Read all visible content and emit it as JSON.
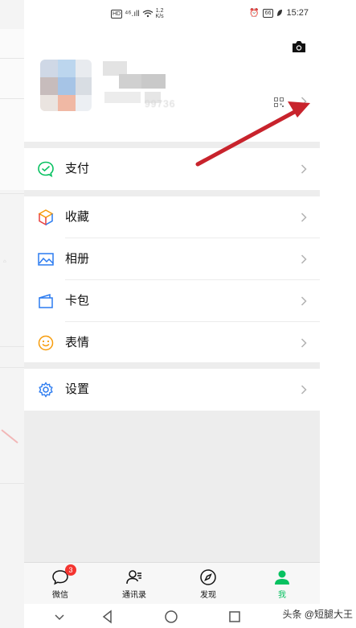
{
  "status_bar": {
    "left_badge": "HD",
    "signal": "⁴⁶.ıll",
    "speed_value": "1.2",
    "speed_unit": "K/s",
    "alarm": "⏰",
    "battery": "66",
    "time": "15:27"
  },
  "profile": {
    "id_fragment": "99736"
  },
  "menu": {
    "pay": "支付",
    "favorites": "收藏",
    "album": "相册",
    "cards": "卡包",
    "stickers": "表情",
    "settings": "设置"
  },
  "tabs": {
    "chats": "微信",
    "chats_badge": "3",
    "contacts": "通讯录",
    "discover": "发现",
    "me": "我"
  },
  "colors": {
    "accent_green": "#07c160",
    "badge_red": "#f43530",
    "arrow_red": "#c8232c"
  },
  "watermark": "头条 @短腿大王"
}
